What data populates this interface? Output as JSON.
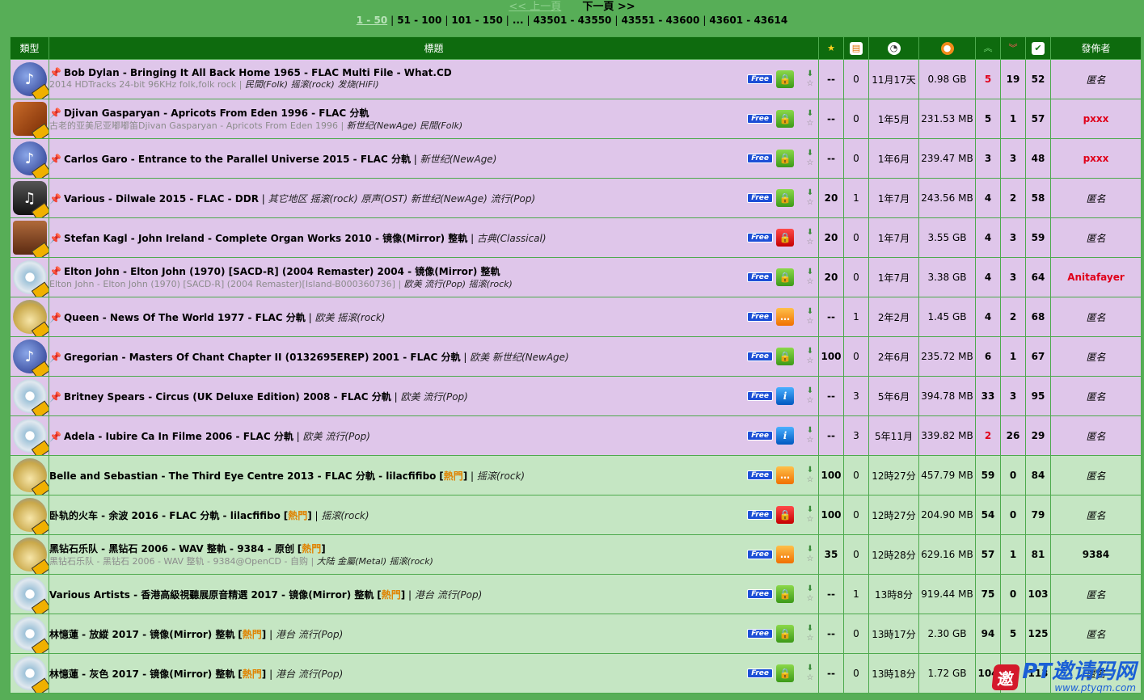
{
  "pager": {
    "prev": "<< 上一頁",
    "next": "下一頁 >>",
    "current": "1 - 50",
    "pages": [
      "51 - 100",
      "101 - 150",
      "...",
      "43501 - 43550",
      "43551 - 43600",
      "43601 - 43614"
    ]
  },
  "header": {
    "type": "類型",
    "title": "標題",
    "uploader": "發佈者",
    "icons": [
      "bookmark-star-icon",
      "comments-icon",
      "time-icon",
      "size-icon",
      "seeders-icon",
      "leechers-icon",
      "completed-icon"
    ]
  },
  "rows": [
    {
      "cat": "jazz",
      "pinned": true,
      "name": "Bob Dylan - Bringing It All Back Home 1965 - FLAC Multi File - What.CD",
      "hot": false,
      "sub": "2014 HDTracks 24-bit 96KHz folk,folk rock",
      "tags": "民間(Folk) 摇滚(rock) 发烧(HiFi)",
      "tags_on_sub": true,
      "free": "Free",
      "status": "lock",
      "rating": "--",
      "comments": "0",
      "time": "11月17天",
      "size": "0.98 GB",
      "seeders": "5",
      "seeders_red": true,
      "leechers": "19",
      "completed": "52",
      "uploader": "匿名",
      "uploader_style": "anon",
      "color": "purple"
    },
    {
      "cat": "world",
      "pinned": true,
      "name": "Djivan Gasparyan - Apricots From Eden 1996 - FLAC 分軌",
      "hot": false,
      "sub": "古老的亚美尼亚嘟嘟笛Djivan Gasparyan - Apricots From Eden 1996",
      "tags": "新世纪(NewAge) 民間(Folk)",
      "tags_on_sub": true,
      "free": "Free",
      "status": "lock",
      "rating": "--",
      "comments": "0",
      "time": "1年5月",
      "size": "231.53 MB",
      "seeders": "5",
      "seeders_red": false,
      "leechers": "1",
      "completed": "57",
      "uploader": "pxxx",
      "uploader_style": "named",
      "color": "purple"
    },
    {
      "cat": "jazz",
      "pinned": true,
      "name": "Carlos Garo - Entrance to the Parallel Universe 2015 - FLAC 分軌",
      "hot": false,
      "sub": "",
      "tags": "新世纪(NewAge)",
      "tags_on_sub": false,
      "free": "Free",
      "status": "lock",
      "rating": "--",
      "comments": "0",
      "time": "1年6月",
      "size": "239.47 MB",
      "seeders": "3",
      "seeders_red": false,
      "leechers": "3",
      "completed": "48",
      "uploader": "pxxx",
      "uploader_style": "named",
      "color": "purple"
    },
    {
      "cat": "pop",
      "pinned": true,
      "name": "Various - Dilwale 2015 - FLAC - DDR",
      "hot": false,
      "sub": "",
      "tags": "其它地区 摇滚(rock) 原声(OST) 新世纪(NewAge) 流行(Pop)",
      "tags_on_sub": false,
      "free": "Free",
      "status": "lock",
      "rating": "20",
      "comments": "1",
      "time": "1年7月",
      "size": "243.56 MB",
      "seeders": "4",
      "seeders_red": false,
      "leechers": "2",
      "completed": "58",
      "uploader": "匿名",
      "uploader_style": "anon",
      "color": "purple"
    },
    {
      "cat": "classical",
      "pinned": true,
      "name": "Stefan Kagl - John Ireland - Complete Organ Works 2010 - 镜像(Mirror) 整軌",
      "hot": false,
      "sub": "",
      "tags": "古典(Classical)",
      "tags_on_sub": false,
      "free": "Free",
      "status": "lockred",
      "rating": "20",
      "comments": "0",
      "time": "1年7月",
      "size": "3.55 GB",
      "seeders": "4",
      "seeders_red": false,
      "leechers": "3",
      "completed": "59",
      "uploader": "匿名",
      "uploader_style": "anon",
      "color": "purple"
    },
    {
      "cat": "cd",
      "pinned": true,
      "name": "Elton John - Elton John (1970) [SACD-R] (2004 Remaster) 2004 - 镜像(Mirror) 整軌",
      "hot": false,
      "sub": "Elton John - Elton John (1970) [SACD-R] (2004 Remaster)[Island-B000360736]",
      "tags": "欧美 流行(Pop) 摇滚(rock)",
      "tags_on_sub": true,
      "free": "Free",
      "status": "lock",
      "rating": "20",
      "comments": "0",
      "time": "1年7月",
      "size": "3.38 GB",
      "seeders": "4",
      "seeders_red": false,
      "leechers": "3",
      "completed": "64",
      "uploader": "Anitafayer",
      "uploader_style": "named",
      "color": "purple"
    },
    {
      "cat": "rock",
      "pinned": true,
      "name": "Queen - News Of The World 1977 - FLAC 分軌",
      "hot": false,
      "sub": "",
      "tags": "欧美 摇滚(rock)",
      "tags_on_sub": false,
      "free": "Free",
      "status": "chat",
      "rating": "--",
      "comments": "1",
      "time": "2年2月",
      "size": "1.45 GB",
      "seeders": "4",
      "seeders_red": false,
      "leechers": "2",
      "completed": "68",
      "uploader": "匿名",
      "uploader_style": "anon",
      "color": "purple"
    },
    {
      "cat": "jazz",
      "pinned": true,
      "name": "Gregorian - Masters Of Chant Chapter II (0132695EREP) 2001 - FLAC 分軌",
      "hot": false,
      "sub": "",
      "tags": "欧美 新世纪(NewAge)",
      "tags_on_sub": false,
      "free": "Free",
      "status": "lock",
      "rating": "100",
      "comments": "0",
      "time": "2年6月",
      "size": "235.72 MB",
      "seeders": "6",
      "seeders_red": false,
      "leechers": "1",
      "completed": "67",
      "uploader": "匿名",
      "uploader_style": "anon",
      "color": "purple"
    },
    {
      "cat": "cd",
      "pinned": true,
      "name": "Britney Spears - Circus (UK Deluxe Edition) 2008 - FLAC 分軌",
      "hot": false,
      "sub": "",
      "tags": "欧美 流行(Pop)",
      "tags_on_sub": false,
      "free": "Free",
      "status": "info",
      "rating": "--",
      "comments": "3",
      "time": "5年6月",
      "size": "394.78 MB",
      "seeders": "33",
      "seeders_red": false,
      "leechers": "3",
      "completed": "95",
      "uploader": "匿名",
      "uploader_style": "anon",
      "color": "purple"
    },
    {
      "cat": "cd",
      "pinned": true,
      "name": "Adela - Iubire Ca In Filme 2006 - FLAC 分軌",
      "hot": false,
      "sub": "",
      "tags": "欧美 流行(Pop)",
      "tags_on_sub": false,
      "free": "Free",
      "status": "info",
      "rating": "--",
      "comments": "3",
      "time": "5年11月",
      "size": "339.82 MB",
      "seeders": "2",
      "seeders_red": true,
      "leechers": "26",
      "completed": "29",
      "uploader": "匿名",
      "uploader_style": "anon",
      "color": "purple"
    },
    {
      "cat": "rock",
      "pinned": false,
      "name": "Belle and Sebastian - The Third Eye Centre 2013 - FLAC 分軌 - lilacfifibo",
      "hot": true,
      "sub": "",
      "tags": "摇滚(rock)",
      "tags_on_sub": false,
      "free": "Free",
      "status": "chat",
      "rating": "100",
      "comments": "0",
      "time": "12時27分",
      "size": "457.79 MB",
      "seeders": "59",
      "seeders_red": false,
      "leechers": "0",
      "completed": "84",
      "uploader": "匿名",
      "uploader_style": "anon",
      "color": "green"
    },
    {
      "cat": "rock",
      "pinned": false,
      "name": "卧轨的火车 - 余波 2016 - FLAC 分軌 - lilacfifibo",
      "hot": true,
      "sub": "",
      "tags": "摇滚(rock)",
      "tags_on_sub": false,
      "free": "Free",
      "status": "lockred",
      "rating": "100",
      "comments": "0",
      "time": "12時27分",
      "size": "204.90 MB",
      "seeders": "54",
      "seeders_red": false,
      "leechers": "0",
      "completed": "79",
      "uploader": "匿名",
      "uploader_style": "anon",
      "color": "green"
    },
    {
      "cat": "rock",
      "pinned": false,
      "name": "黑钻石乐队 - 黑钻石 2006 - WAV 整軌 - 9384 - 原创",
      "hot": true,
      "sub": "黑钻石乐队 - 黑钻石 2006 - WAV 整轨 - 9384@OpenCD - 自购",
      "tags": "大陆 金屬(Metal) 摇滚(rock)",
      "tags_on_sub": true,
      "free": "Free",
      "status": "chat",
      "rating": "35",
      "comments": "0",
      "time": "12時28分",
      "size": "629.16 MB",
      "seeders": "57",
      "seeders_red": false,
      "leechers": "1",
      "completed": "81",
      "uploader": "9384",
      "uploader_style": "plain",
      "color": "green"
    },
    {
      "cat": "cd",
      "pinned": false,
      "name": "Various Artists - 香港高級視聽展原音精選 2017 - 镜像(Mirror) 整軌",
      "hot": true,
      "sub": "",
      "tags": "港台 流行(Pop)",
      "tags_on_sub": false,
      "free": "Free",
      "status": "lock",
      "rating": "--",
      "comments": "1",
      "time": "13時8分",
      "size": "919.44 MB",
      "seeders": "75",
      "seeders_red": false,
      "leechers": "0",
      "completed": "103",
      "uploader": "匿名",
      "uploader_style": "anon",
      "color": "green"
    },
    {
      "cat": "cd",
      "pinned": false,
      "name": "林憶蓮 - 放縱 2017 - 镜像(Mirror) 整軌",
      "hot": true,
      "sub": "",
      "tags": "港台 流行(Pop)",
      "tags_on_sub": false,
      "free": "Free",
      "status": "lock",
      "rating": "--",
      "comments": "0",
      "time": "13時17分",
      "size": "2.30 GB",
      "seeders": "94",
      "seeders_red": false,
      "leechers": "5",
      "completed": "125",
      "uploader": "匿名",
      "uploader_style": "anon",
      "color": "green"
    },
    {
      "cat": "cd",
      "pinned": false,
      "name": "林憶蓮 - 灰色 2017 - 镜像(Mirror) 整軌",
      "hot": true,
      "sub": "",
      "tags": "港台 流行(Pop)",
      "tags_on_sub": false,
      "free": "Free",
      "status": "lock",
      "rating": "--",
      "comments": "0",
      "time": "13時18分",
      "size": "1.72 GB",
      "seeders": "104",
      "seeders_red": false,
      "leechers": "4",
      "completed": "113",
      "uploader": "匿名",
      "uploader_style": "anon",
      "color": "green"
    }
  ],
  "hot_label": "熱門",
  "watermark": {
    "main": "PT邀请码网",
    "url": "www.ptyqm.com",
    "logo": "邀"
  }
}
